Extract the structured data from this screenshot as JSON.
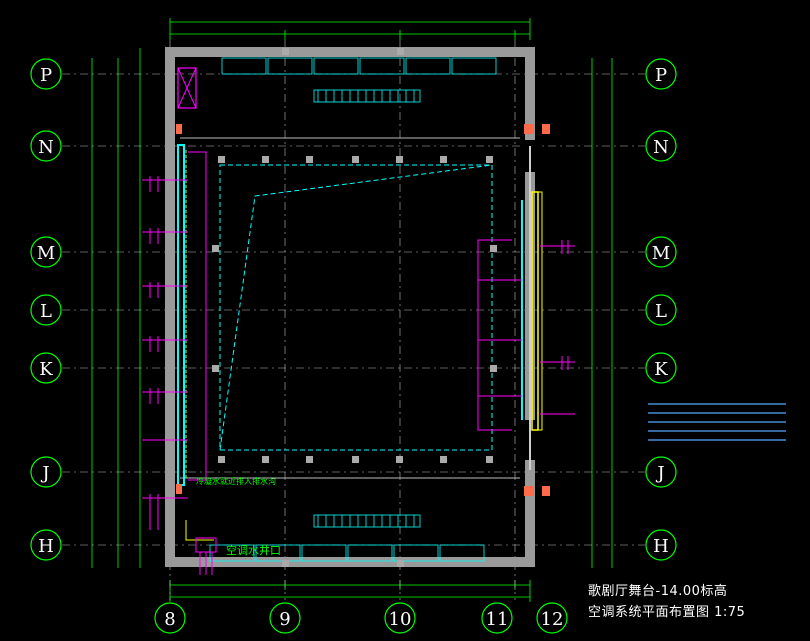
{
  "drawing": {
    "row_axes": [
      "P",
      "N",
      "M",
      "L",
      "K",
      "J",
      "H"
    ],
    "col_axes": [
      "8",
      "9",
      "10",
      "11",
      "12"
    ],
    "annotations": {
      "cooling_note": "冷凝水就近排入排水沟",
      "shaft_label": "空调水井口"
    },
    "title_line1": "歌剧厅舞台-14.00标高",
    "title_line2": "空调系统平面布置图 1:75",
    "colors": {
      "background": "#000000",
      "axis": "#00ff00",
      "wall": "#9a9a9a",
      "duct": "#00ffff",
      "pipe": "#ff00ff",
      "equipment": "#ffff00",
      "dim": "#00ff00",
      "grid": "#bbbbbb"
    }
  }
}
